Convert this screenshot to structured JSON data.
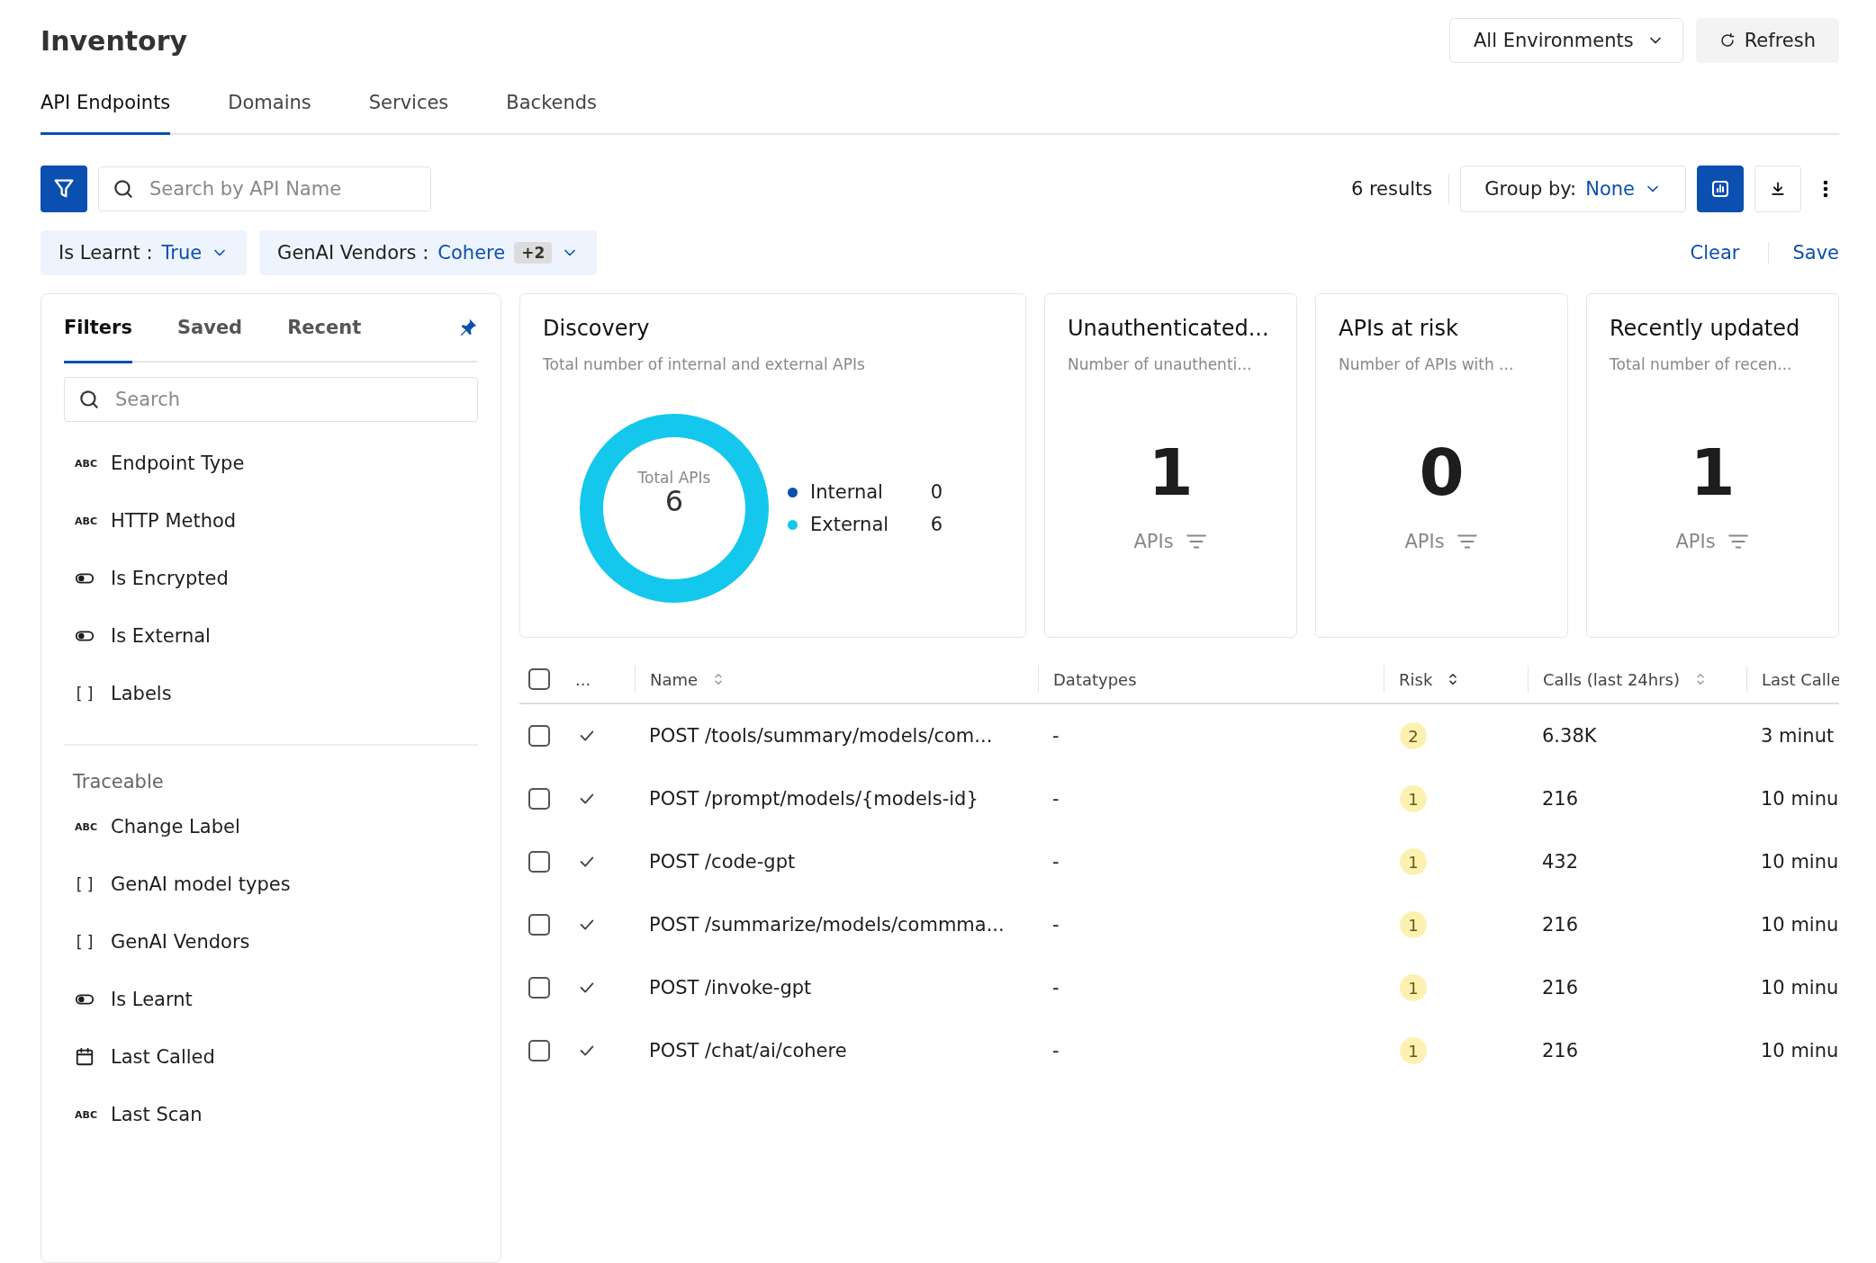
{
  "page": {
    "title": "Inventory",
    "environment": "All Environments",
    "refresh": "Refresh"
  },
  "tabs": [
    {
      "label": "API Endpoints",
      "selected": true
    },
    {
      "label": "Domains",
      "selected": false
    },
    {
      "label": "Services",
      "selected": false
    },
    {
      "label": "Backends",
      "selected": false
    }
  ],
  "toolbar": {
    "search": {
      "placeholder": "Search by API Name"
    },
    "results": "6 results",
    "group_by": {
      "label": "Group by:",
      "value": "None"
    },
    "chart_view_on": true
  },
  "chips": [
    {
      "field": "Is Learnt :",
      "value": "True"
    },
    {
      "field": "GenAI Vendors :",
      "value": "Cohere",
      "more": "+2"
    }
  ],
  "chip_actions": [
    "Clear",
    "Save"
  ],
  "sidebar": {
    "tabs": [
      {
        "label": "Filters",
        "selected": true
      },
      {
        "label": "Saved",
        "selected": false
      },
      {
        "label": "Recent",
        "selected": false
      }
    ],
    "pinned": true,
    "search": {
      "placeholder": "Search"
    },
    "groups": [
      {
        "items": [
          {
            "label": "Endpoint Type",
            "kind": "string",
            "glyph": "ABC"
          },
          {
            "label": "HTTP Method",
            "kind": "string",
            "glyph": "ABC"
          },
          {
            "label": "Is Encrypted",
            "kind": "boolean"
          },
          {
            "label": "Is External",
            "kind": "boolean"
          },
          {
            "label": "Labels",
            "kind": "list",
            "glyph": "[ ]"
          }
        ]
      },
      {
        "heading": "Traceable",
        "items": [
          {
            "label": "Change Label",
            "kind": "string",
            "glyph": "ABC"
          },
          {
            "label": "GenAI model types",
            "kind": "list",
            "glyph": "[ ]"
          },
          {
            "label": "GenAI Vendors",
            "kind": "list",
            "glyph": "[ ]"
          },
          {
            "label": "Is Learnt",
            "kind": "boolean"
          },
          {
            "label": "Last Called",
            "kind": "date"
          },
          {
            "label": "Last Scan",
            "kind": "string",
            "glyph": "ABC"
          }
        ]
      }
    ]
  },
  "discovery": {
    "title": "Discovery",
    "subtitle": "Total number of internal and external APIs",
    "center_label": "Total APIs",
    "center_value": "6",
    "chart_data": {
      "type": "pie",
      "categories": [
        "Internal",
        "External"
      ],
      "series": [
        {
          "values": [
            0,
            100
          ]
        }
      ],
      "colors": [
        "#0b4fb0",
        "#13c8ec"
      ],
      "value_labels": [
        "0",
        "6"
      ]
    }
  },
  "stat_cards": [
    {
      "title": "Unauthenticated...",
      "subtitle": "Number of unauthenti...",
      "value": "1",
      "unit": "APIs"
    },
    {
      "title": "APIs at risk",
      "subtitle": "Number of APIs with ...",
      "value": "0",
      "unit": "APIs"
    },
    {
      "title": "Recently updated",
      "subtitle": "Total number of recen...",
      "value": "1",
      "unit": "APIs"
    }
  ],
  "table": {
    "all_checked": false,
    "columns": [
      {
        "label": "...",
        "sortable": false
      },
      {
        "label": "Name",
        "sortable": true
      },
      {
        "label": "Datatypes",
        "sortable": false
      },
      {
        "label": "Risk",
        "sortable": true
      },
      {
        "label": "Calls (last 24hrs)",
        "sortable": true
      },
      {
        "label": "Last Calle",
        "sortable": false
      }
    ],
    "rows": [
      {
        "checked": false,
        "learnt": true,
        "name": "POST /tools/summary/models/com...",
        "datatypes": "-",
        "risk": "2",
        "calls": "6.38K",
        "last_called": "3 minut"
      },
      {
        "checked": false,
        "learnt": true,
        "name": "POST /prompt/models/{models-id}",
        "datatypes": "-",
        "risk": "1",
        "calls": "216",
        "last_called": "10 minu"
      },
      {
        "checked": false,
        "learnt": true,
        "name": "POST /code-gpt",
        "datatypes": "-",
        "risk": "1",
        "calls": "432",
        "last_called": "10 minu"
      },
      {
        "checked": false,
        "learnt": true,
        "name": "POST /summarize/models/commma...",
        "datatypes": "-",
        "risk": "1",
        "calls": "216",
        "last_called": "10 minu"
      },
      {
        "checked": false,
        "learnt": true,
        "name": "POST /invoke-gpt",
        "datatypes": "-",
        "risk": "1",
        "calls": "216",
        "last_called": "10 minu"
      },
      {
        "checked": false,
        "learnt": true,
        "name": "POST /chat/ai/cohere",
        "datatypes": "-",
        "risk": "1",
        "calls": "216",
        "last_called": "10 minu"
      }
    ]
  }
}
